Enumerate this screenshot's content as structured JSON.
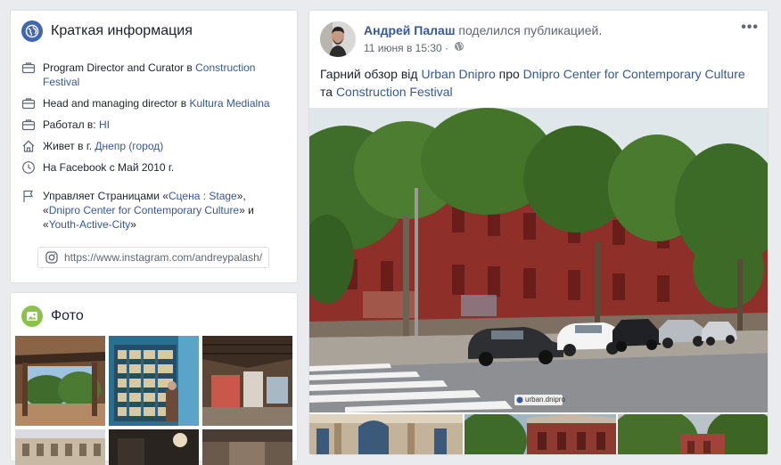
{
  "intro": {
    "title": "Краткая информация",
    "rows": [
      {
        "icon": "briefcase-icon",
        "prefix": "Program Director and Curator в ",
        "link": "Construction Festival"
      },
      {
        "icon": "briefcase-icon",
        "prefix": "Head and managing director в ",
        "link": "Kultura Medialna"
      },
      {
        "icon": "briefcase-icon",
        "prefix": "Работал в: ",
        "link": "HI"
      },
      {
        "icon": "home-icon",
        "prefix": "Живет в г. ",
        "link": "Днепр (город)"
      },
      {
        "icon": "clock-icon",
        "prefix": "На Facebook с Май 2010 г.",
        "link": ""
      }
    ],
    "pages": {
      "prefix": "Управляет Страницами «",
      "page1": "Сцена : Stage",
      "sep1": "»,",
      "open2": "«",
      "page2": "Dnipro Center for Contemporary Culture",
      "sep2": "» и",
      "open3": "«",
      "page3": "Youth-Active-City",
      "close3": "»"
    },
    "instagram": "https://www.instagram.com/andreypalash/"
  },
  "photos": {
    "title": "Фото"
  },
  "post": {
    "author": "Андрей Палаш",
    "action": "поделился публикацией.",
    "time": "11 июня в 15:30 ·",
    "more": "•••",
    "text": {
      "t1": "Гарний обзор від ",
      "l1": "Urban Dnipro",
      "t2": " про ",
      "l2": "Dnipro Center for Contemporary Culture",
      "t3": "та ",
      "l3": "Construction Festival"
    },
    "watermark": "urban.dnipro"
  },
  "colors": {
    "link": "#365899",
    "background": "#e9ebee",
    "globe": "#4267b2",
    "photo_icon": "#8bc34a"
  }
}
